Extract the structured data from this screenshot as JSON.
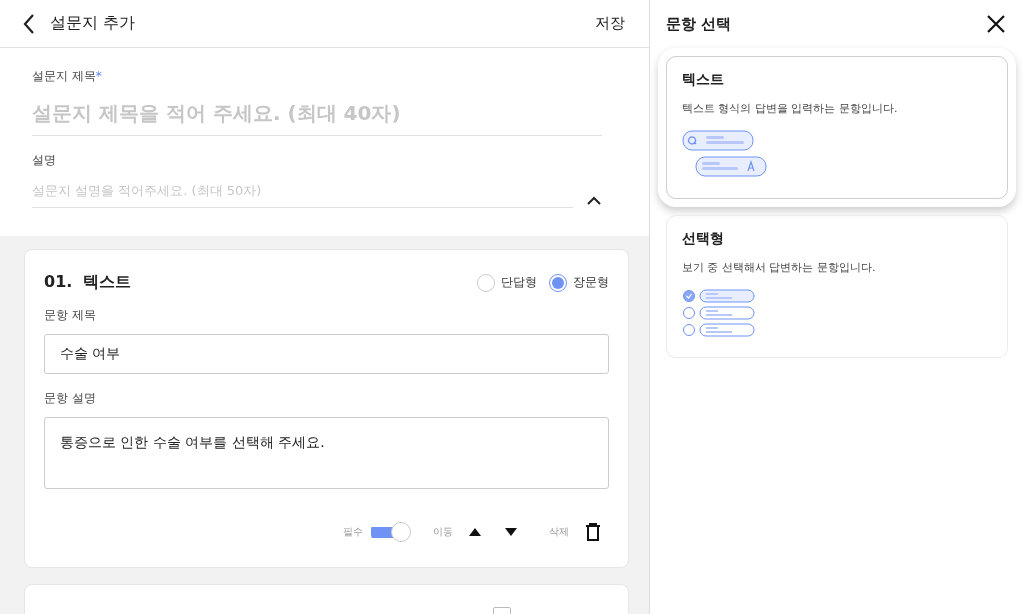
{
  "header": {
    "title": "설문지 추가",
    "save": "저장"
  },
  "survey": {
    "title_label": "설문지 제목",
    "required_mark": "*",
    "title_placeholder": "설문지 제목을 적어 주세요. (최대 40자)",
    "desc_label": "설명",
    "desc_placeholder": "설문지 설명을 적어주세요. (최대 50자)",
    "expanded": true
  },
  "questions": [
    {
      "kind": "text",
      "number": "01.",
      "title": "텍스트",
      "answer_types": [
        {
          "label": "단답형",
          "selected": false
        },
        {
          "label": "장문형",
          "selected": true
        }
      ],
      "title_label": "문항 제목",
      "title_value": "수술 여부",
      "desc_label": "문항 설명",
      "desc_value": "통증으로 인한 수술 여부를 선택해 주세요.",
      "required_label": "필수",
      "required": true,
      "move_label": "이동",
      "delete_label": "삭제"
    },
    {
      "kind": "choice",
      "multi": false
    }
  ],
  "panel": {
    "title": "문항 선택",
    "options": [
      {
        "kind": "text",
        "title": "텍스트",
        "description": "텍스트 형식의 답변을 입력하는 문항입니다.",
        "selected": true
      },
      {
        "kind": "choice",
        "title": "선택형",
        "description": "보기 중 선택해서 답변하는 문항입니다.",
        "selected": false
      }
    ]
  }
}
